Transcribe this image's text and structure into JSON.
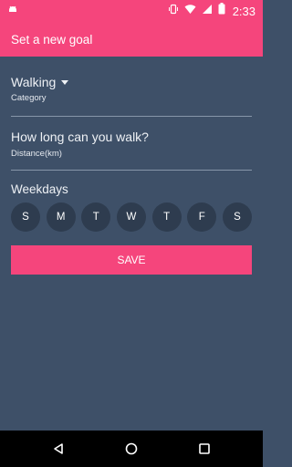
{
  "status_bar": {
    "time": "2:33",
    "icons": [
      "android-notification-icon",
      "vibrate-icon",
      "wifi-icon",
      "cell-signal-icon",
      "battery-icon"
    ]
  },
  "app_bar": {
    "title": "Set a new goal"
  },
  "category": {
    "value": "Walking",
    "label": "Category"
  },
  "distance": {
    "placeholder": "How long can you walk?",
    "label": "Distance(km)"
  },
  "weekdays": {
    "title": "Weekdays",
    "days": [
      "S",
      "M",
      "T",
      "W",
      "T",
      "F",
      "S"
    ]
  },
  "save_button": {
    "label": "SAVE"
  },
  "nav_bar": {
    "icons": [
      "back-icon",
      "home-icon",
      "recents-icon"
    ]
  },
  "colors": {
    "accent": "#f5457c",
    "background": "#3e5068",
    "day_circle": "#2e3c4f"
  }
}
